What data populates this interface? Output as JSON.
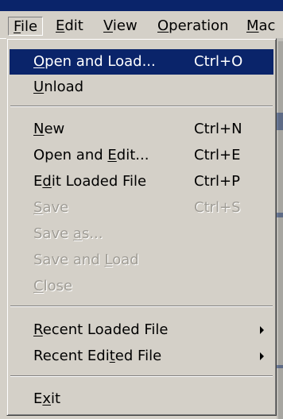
{
  "menubar": {
    "items": [
      {
        "label": "File",
        "underline": "F",
        "rest": "ile"
      },
      {
        "label": "Edit",
        "underline": "E",
        "rest": "dit"
      },
      {
        "label": "View",
        "underline": "V",
        "rest": "iew"
      },
      {
        "label": "Operation",
        "underline": "O",
        "rest": "peration"
      },
      {
        "label": "Mac",
        "underline": "M",
        "rest": "ac"
      }
    ]
  },
  "file_menu": {
    "open_and_load": {
      "pre": "",
      "ul": "O",
      "post": "pen and Load...",
      "shortcut": "Ctrl+O"
    },
    "unload": {
      "pre": "",
      "ul": "U",
      "post": "nload",
      "shortcut": ""
    },
    "new": {
      "pre": "",
      "ul": "N",
      "post": "ew",
      "shortcut": "Ctrl+N"
    },
    "open_and_edit": {
      "pre": "Open and ",
      "ul": "E",
      "post": "dit...",
      "shortcut": "Ctrl+E"
    },
    "edit_loaded_file": {
      "pre": "E",
      "ul": "d",
      "post": "it Loaded File",
      "shortcut": "Ctrl+P"
    },
    "save": {
      "pre": "",
      "ul": "S",
      "post": "ave",
      "shortcut": "Ctrl+S"
    },
    "save_as": {
      "pre": "Save ",
      "ul": "a",
      "post": "s...",
      "shortcut": ""
    },
    "save_and_load": {
      "pre": "Save and ",
      "ul": "L",
      "post": "oad",
      "shortcut": ""
    },
    "close": {
      "pre": "",
      "ul": "C",
      "post": "lose",
      "shortcut": ""
    },
    "recent_loaded_file": {
      "pre": "",
      "ul": "R",
      "post": "ecent Loaded File",
      "shortcut": ""
    },
    "recent_edited_file": {
      "pre": "Recent Edi",
      "ul": "t",
      "post": "ed File",
      "shortcut": ""
    },
    "exit": {
      "pre": "E",
      "ul": "x",
      "post": "it",
      "shortcut": ""
    }
  },
  "colors": {
    "highlight": "#0a246a",
    "menu_bg": "#d4d0c8",
    "disabled_text": "#a09d96"
  }
}
